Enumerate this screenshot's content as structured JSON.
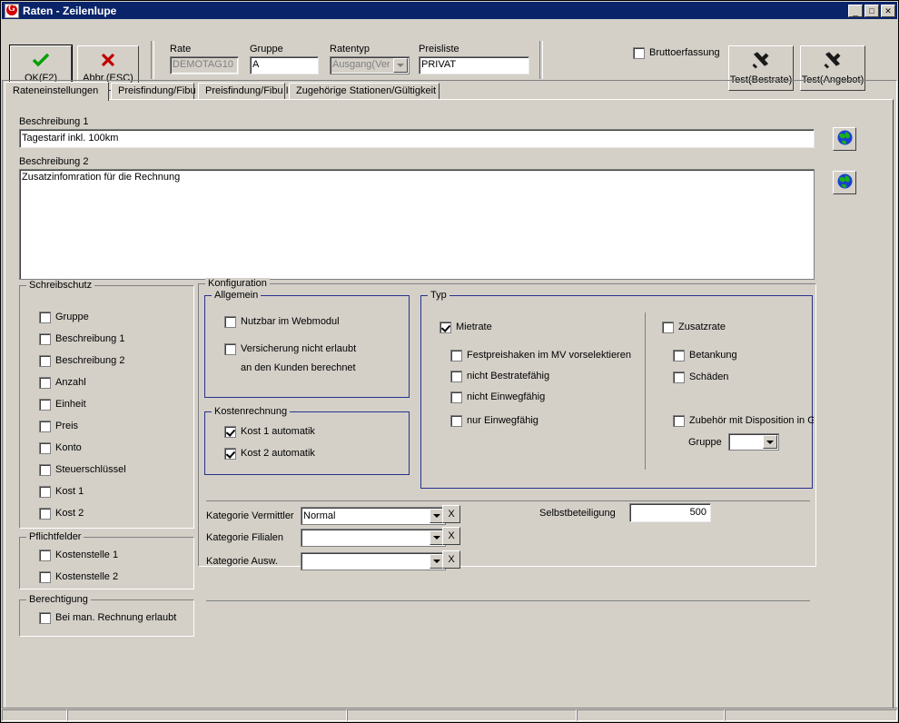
{
  "window": {
    "title": "Raten - Zeilenlupe",
    "icon": "app-icon",
    "minimize": "_",
    "maximize": "□",
    "close": "✕"
  },
  "toolbar": {
    "ok_label": "OK(F2)",
    "ok_icon": "check-icon",
    "cancel_label": "Abbr.(ESC)",
    "cancel_icon": "x-icon",
    "test_bestrate_label": "Test(Bestrate)",
    "test_angebot_label": "Test(Angebot)",
    "tools_icon": "tools-icon",
    "brutto_label": "Bruttoerfassung",
    "brutto_checked": false,
    "fields": [
      {
        "label": "Rate",
        "value": "DEMOTAG10",
        "type": "text",
        "disabled": true
      },
      {
        "label": "Gruppe",
        "value": "A",
        "type": "text",
        "disabled": false
      },
      {
        "label": "Ratentyp",
        "value": "Ausgang(Ver",
        "type": "combo",
        "disabled": true
      },
      {
        "label": "Preisliste",
        "value": "PRIVAT",
        "type": "text",
        "disabled": false
      }
    ]
  },
  "tabs": [
    {
      "label": "Rateneinstellungen",
      "active": true
    },
    {
      "label": "Preisfindung/Fibu I",
      "active": false
    },
    {
      "label": "Preisfindung/Fibu II",
      "active": false
    },
    {
      "label": "Zugehörige Stationen/Gültigkeit",
      "active": false
    }
  ],
  "main": {
    "beschreibung1_label": "Beschreibung 1",
    "beschreibung1_value": "Tagestarif inkl. 100km",
    "beschreibung2_label": "Beschreibung 2",
    "beschreibung2_value": "Zusatzinfomration für die Rechnung",
    "globe_icon": "globe-icon"
  },
  "schreibschutz": {
    "caption": "Schreibschutz",
    "items": [
      {
        "label": "Gruppe",
        "checked": false
      },
      {
        "label": "Beschreibung 1",
        "checked": false
      },
      {
        "label": "Beschreibung 2",
        "checked": false
      },
      {
        "label": "Anzahl",
        "checked": false
      },
      {
        "label": "Einheit",
        "checked": false
      },
      {
        "label": "Preis",
        "checked": false
      },
      {
        "label": "Konto",
        "checked": false
      },
      {
        "label": "Steuerschlüssel",
        "checked": false
      },
      {
        "label": "Kost 1",
        "checked": false
      },
      {
        "label": "Kost 2",
        "checked": false
      }
    ]
  },
  "pflichtfelder": {
    "caption": "Pflichtfelder",
    "items": [
      {
        "label": "Kostenstelle 1",
        "checked": false
      },
      {
        "label": "Kostenstelle 2",
        "checked": false
      }
    ]
  },
  "berechtigung": {
    "caption": "Berechtigung",
    "items": [
      {
        "label": "Bei man. Rechnung erlaubt",
        "checked": false
      }
    ]
  },
  "konfiguration": {
    "caption": "Konfiguration",
    "allgemein": {
      "caption": "Allgemein",
      "items": [
        {
          "label": "Nutzbar im Webmodul",
          "checked": false
        },
        {
          "label": "Versicherung nicht erlaubt",
          "checked": false
        }
      ],
      "note": "an den Kunden berechnet"
    },
    "kostenrechnung": {
      "caption": "Kostenrechnung",
      "items": [
        {
          "label": "Kost 1 automatik",
          "checked": true
        },
        {
          "label": "Kost 2 automatik",
          "checked": true
        }
      ]
    },
    "typ": {
      "caption": "Typ",
      "mietrate": {
        "label": "Mietrate",
        "checked": true
      },
      "mietrate_sub": [
        {
          "label": "Festpreishaken im MV vorselektieren",
          "checked": false
        },
        {
          "label": "nicht Bestratefähig",
          "checked": false
        },
        {
          "label": "nicht Einwegfähig",
          "checked": false
        },
        {
          "label": "nur Einwegfähig",
          "checked": false
        }
      ],
      "zusatzrate": {
        "label": "Zusatzrate",
        "checked": false
      },
      "zusatzrate_sub": [
        {
          "label": "Betankung",
          "checked": false
        },
        {
          "label": "Schäden",
          "checked": false
        }
      ],
      "zubehoer": {
        "label": "Zubehör mit Disposition in Gruppe",
        "checked": false
      },
      "zubehoer_gruppe_label": "Gruppe",
      "zubehoer_gruppe_value": ""
    },
    "kategorien": [
      {
        "label": "Kategorie Vermittler",
        "value": "Normal",
        "clear": "X"
      },
      {
        "label": "Kategorie Filialen",
        "value": "",
        "clear": "X"
      },
      {
        "label": "Kategorie Ausw.",
        "value": "",
        "clear": "X"
      }
    ],
    "selbstbeteiligung_label": "Selbstbeteiligung",
    "selbstbeteiligung_value": "500"
  },
  "statusbar": {
    "cells": [
      "",
      "",
      "",
      ""
    ]
  },
  "colors": {
    "face": "#d4d0c8",
    "titlebar": "#0a246a",
    "group_blue": "#26318c",
    "ok_green": "#00a000",
    "cancel_red": "#c00000"
  }
}
